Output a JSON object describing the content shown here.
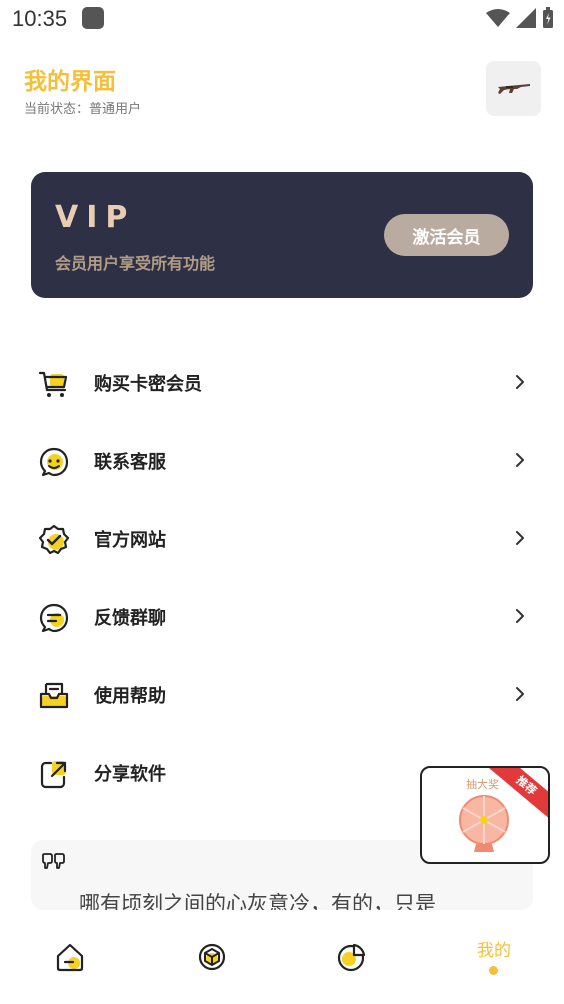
{
  "status": {
    "time": "10:35"
  },
  "header": {
    "title": "我的界面",
    "subtitle": "当前状态：普通用户"
  },
  "vip": {
    "title": "VIP",
    "desc": "会员用户享受所有功能",
    "button": "激活会员"
  },
  "menu": [
    {
      "label": "购买卡密会员",
      "icon": "cart-icon"
    },
    {
      "label": "联系客服",
      "icon": "chat-face-icon"
    },
    {
      "label": "官方网站",
      "icon": "verified-badge-icon"
    },
    {
      "label": "反馈群聊",
      "icon": "message-icon"
    },
    {
      "label": "使用帮助",
      "icon": "inbox-icon"
    },
    {
      "label": "分享软件",
      "icon": "share-icon"
    }
  ],
  "quote": {
    "text": "哪有顷刻之间的心灰意冷，有的，只是"
  },
  "lottery": {
    "label": "抽大奖",
    "ribbon": "推荐"
  },
  "nav": {
    "active_label": "我的"
  },
  "colors": {
    "accent": "#f5bf3a",
    "vip_card": "#2e3146",
    "vip_gold": "#e9cdb3"
  }
}
